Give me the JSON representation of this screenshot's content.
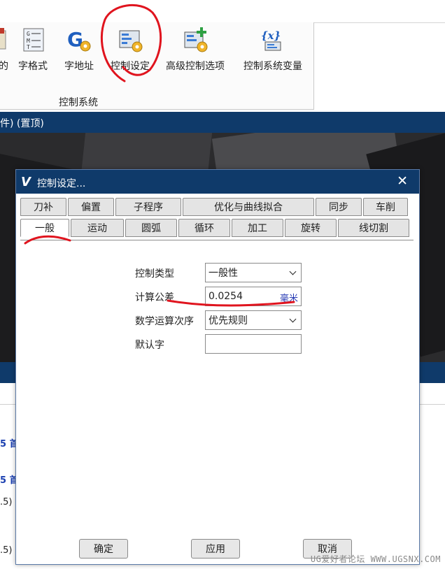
{
  "ribbon": {
    "items": [
      {
        "label": "的",
        "icon": "report-icon"
      },
      {
        "label": "字格式",
        "icon": "word-format-icon"
      },
      {
        "label": "字地址",
        "icon": "word-address-icon"
      },
      {
        "label": "控制设定",
        "icon": "control-settings-icon"
      },
      {
        "label": "高级控制选项",
        "icon": "advanced-control-icon"
      },
      {
        "label": "控制系统变量",
        "icon": "system-variable-icon"
      }
    ],
    "group_label": "控制系统"
  },
  "app": {
    "title_fragment": "件) (置顶)",
    "side_lines": [
      "5 首",
      "5 首",
      ".5)",
      ".5)"
    ]
  },
  "dialog": {
    "title": "控制设定...",
    "close_glyph": "✕",
    "tabs_row1": [
      "刀补",
      "偏置",
      "子程序",
      "优化与曲线拟合",
      "同步",
      "车削"
    ],
    "tabs_row2": [
      "一般",
      "运动",
      "圆弧",
      "循环",
      "加工",
      "旋转",
      "线切割"
    ],
    "active_tab": "一般",
    "fields": {
      "control_type": {
        "label": "控制类型",
        "value": "一般性"
      },
      "tolerance": {
        "label": "计算公差",
        "value": "0.0254",
        "unit": "毫米"
      },
      "math_order": {
        "label": "数学运算次序",
        "value": "优先规则"
      },
      "default_word": {
        "label": "默认字",
        "value": ""
      }
    },
    "buttons": {
      "ok": "确定",
      "apply": "应用",
      "cancel": "取消"
    }
  },
  "watermark": "UG爱好者论坛 WWW.UGSNX.COM",
  "colors": {
    "title_bar": "#0f3a6a",
    "annotation": "#e0141e",
    "unit": "#2a3db5"
  }
}
